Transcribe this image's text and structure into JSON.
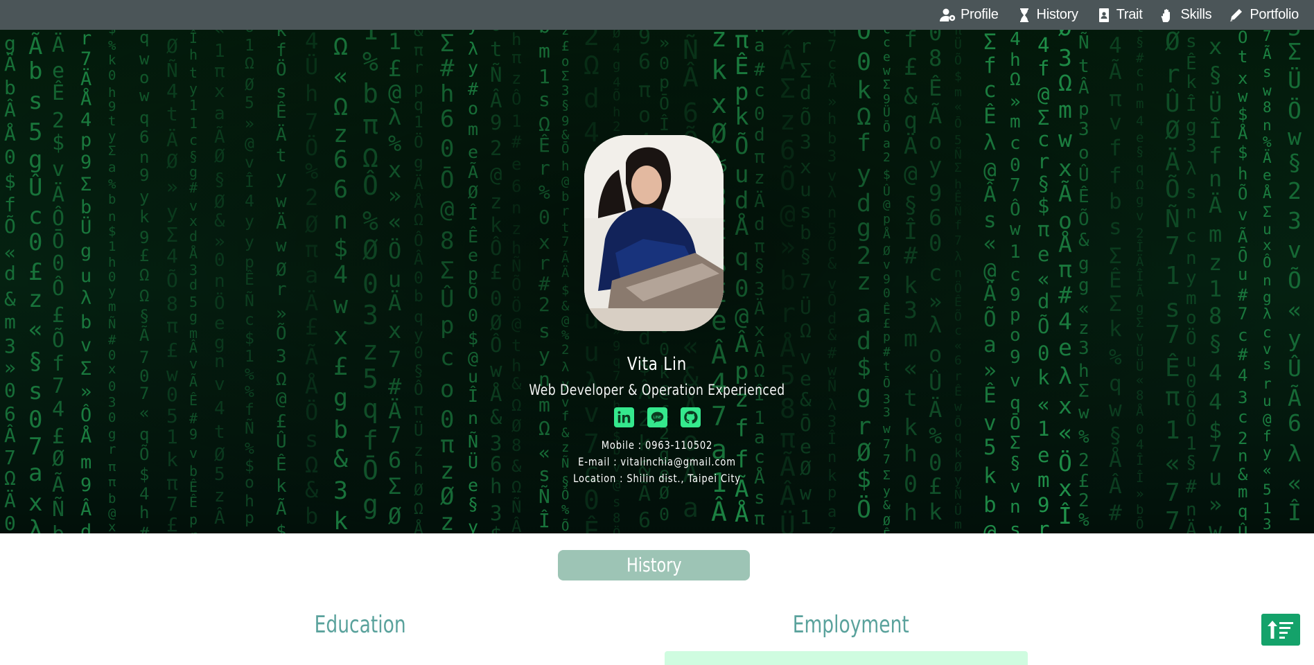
{
  "nav": {
    "items": [
      {
        "label": "Profile",
        "icon": "user-gear-icon"
      },
      {
        "label": "History",
        "icon": "hourglass-icon"
      },
      {
        "label": "Trait",
        "icon": "id-badge-icon"
      },
      {
        "label": "Skills",
        "icon": "hand-icon"
      },
      {
        "label": "Portfolio",
        "icon": "pencil-icon"
      }
    ]
  },
  "profile": {
    "name": "Vita Lin",
    "title": "Web Developer & Operation Experienced",
    "socials": [
      {
        "icon": "linkedin-icon"
      },
      {
        "icon": "line-icon"
      },
      {
        "icon": "github-icon"
      }
    ],
    "mobile": "Mobile : 0963-110502",
    "email": "E-mail : vitalinchia@gmail.com",
    "location": "Location : Shilin  dist.,  Taipei  City"
  },
  "history": {
    "section_title": "History",
    "education_title": "Education",
    "employment_title": "Employment"
  },
  "colors": {
    "navbar": "#4b5558",
    "matrix_green": "#2fd36b",
    "social_green": "#35e88d",
    "pill": "#9dc4b5",
    "heading_teal": "#5aa29c",
    "scroll_button": "#14a26a"
  }
}
